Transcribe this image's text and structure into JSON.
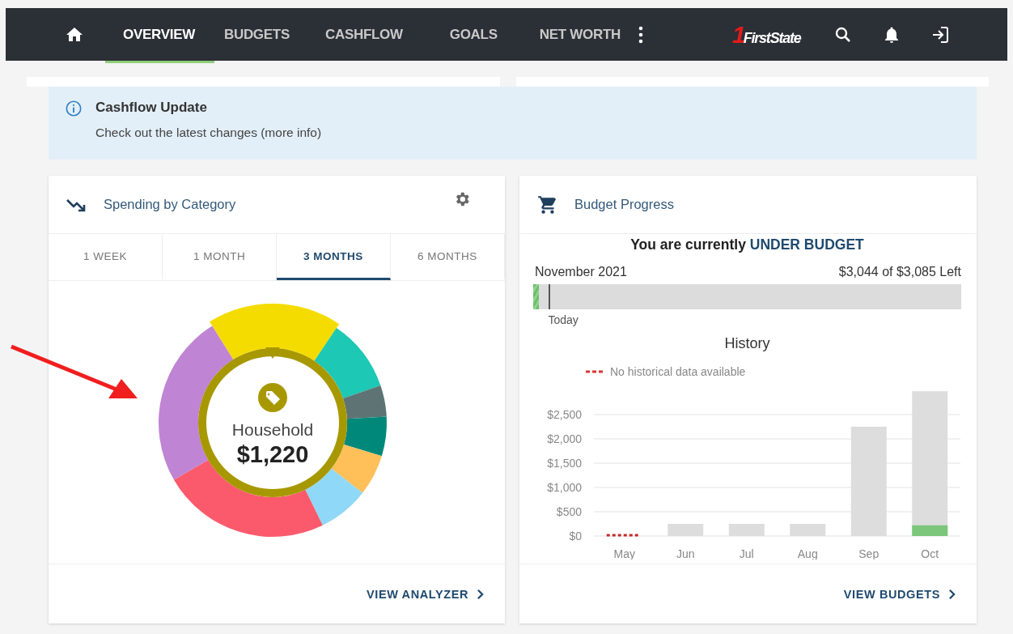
{
  "nav": {
    "items": [
      {
        "label": "OVERVIEW",
        "selected": true
      },
      {
        "label": "BUDGETS",
        "selected": false
      },
      {
        "label": "CASHFLOW",
        "selected": false
      },
      {
        "label": "GOALS",
        "selected": false
      },
      {
        "label": "NET WORTH",
        "selected": false
      }
    ],
    "logo": {
      "mark": "1",
      "name": "FirstState"
    }
  },
  "banner": {
    "title": "Cashflow Update",
    "text": "Check out the latest changes (more info)"
  },
  "spending": {
    "title": "Spending by Category",
    "tabs": [
      {
        "label": "1 WEEK",
        "selected": false
      },
      {
        "label": "1 MONTH",
        "selected": false
      },
      {
        "label": "3 MONTHS",
        "selected": true
      },
      {
        "label": "6 MONTHS",
        "selected": false
      }
    ],
    "category": "Household",
    "amount": "$1,220",
    "link": "VIEW ANALYZER"
  },
  "budget": {
    "title": "Budget Progress",
    "status_prefix": "You are currently",
    "status": "UNDER BUDGET",
    "month": "November 2021",
    "remaining": "$3,044 of $3,085 Left",
    "level": 0.014,
    "today_marker": {
      "label": "Today",
      "level": 0.035
    },
    "history_title": "History",
    "legend": "No historical data available",
    "link": "VIEW BUDGETS",
    "chart_data": {
      "type": "bar",
      "categories": [
        "May",
        "Jun",
        "Jul",
        "Aug",
        "Sep",
        "Oct"
      ],
      "series": [
        {
          "color": "#dddddd",
          "values": [
            null,
            250,
            250,
            250,
            2250,
            2980
          ]
        },
        {
          "color": "#7bc67b",
          "values": [
            null,
            null,
            null,
            null,
            null,
            220
          ]
        }
      ],
      "grid": true,
      "ylim": [
        0,
        3000
      ],
      "yticks": [
        {
          "value": 0,
          "label": "$0"
        },
        {
          "value": 500,
          "label": "$500"
        },
        {
          "value": 1000,
          "label": "$1,000"
        },
        {
          "value": 1500,
          "label": "$1,500"
        },
        {
          "value": 2000,
          "label": "$2,000"
        },
        {
          "value": 2500,
          "label": "$2,500"
        }
      ],
      "stacked": false
    }
  }
}
